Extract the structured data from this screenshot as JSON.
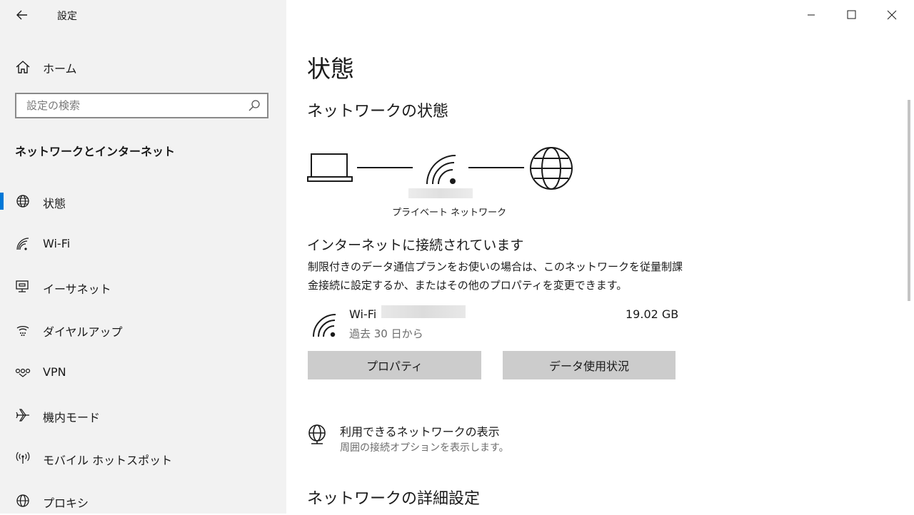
{
  "window": {
    "title": "設定",
    "controls": [
      "minimize-icon",
      "maximize-icon",
      "close-icon"
    ]
  },
  "sidebar": {
    "home_label": "ホーム",
    "search_placeholder": "設定の検索",
    "section_title": "ネットワークとインターネット",
    "items": [
      {
        "label": "状態",
        "icon": "globe-icon",
        "selected": true
      },
      {
        "label": "Wi-Fi",
        "icon": "wifi-icon",
        "selected": false
      },
      {
        "label": "イーサネット",
        "icon": "ethernet-icon",
        "selected": false
      },
      {
        "label": "ダイヤルアップ",
        "icon": "dialup-icon",
        "selected": false
      },
      {
        "label": "VPN",
        "icon": "vpn-icon",
        "selected": false
      },
      {
        "label": "機内モード",
        "icon": "airplane-icon",
        "selected": false
      },
      {
        "label": "モバイル ホットスポット",
        "icon": "hotspot-icon",
        "selected": false
      },
      {
        "label": "プロキシ",
        "icon": "globe-icon",
        "selected": false
      }
    ],
    "accent_color": "#0078d7"
  },
  "main": {
    "page_title": "状態",
    "network_status_title": "ネットワークの状態",
    "network_type": "プライベート ネットワーク",
    "connection_status": "インターネットに接続されています",
    "description": "制限付きのデータ通信プランをお使いの場合は、このネットワークを従量制課金接続に設定するか、またはその他のプロパティを変更できます。",
    "connection": {
      "name": "Wi-Fi",
      "period": "過去 30 日から",
      "usage": "19.02 GB"
    },
    "buttons": {
      "properties": "プロパティ",
      "data_usage": "データ使用状況"
    },
    "available_networks": {
      "title": "利用できるネットワークの表示",
      "subtitle": "周囲の接続オプションを表示します。"
    },
    "advanced_title": "ネットワークの詳細設定"
  }
}
